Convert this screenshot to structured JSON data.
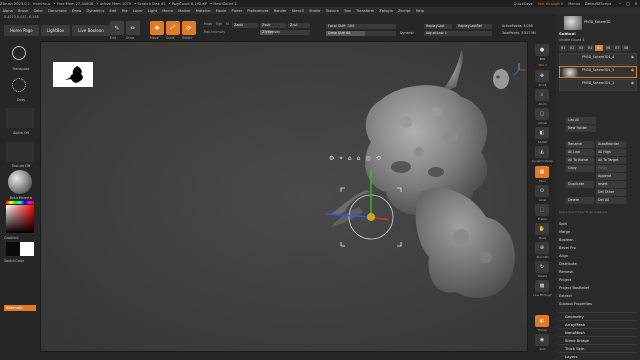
{
  "titlebar": {
    "app": "ZBrush 2023.0.1",
    "project": "rmmmruc",
    "free_mem": "• Free Mem 27.344GB",
    "active_mem": "• Active Mem 1079",
    "scratch_disk": "• Scratch Disk 45",
    "poly_count": "• PolyCount 8.192 KP",
    "mesh_count": "• MeshCount 1",
    "quicksave": "QuickSave",
    "see_through": "See-through 0",
    "menus": "Menus",
    "default_script": "DefaultZScript"
  },
  "menubar": {
    "items": [
      "Alpha",
      "Brush",
      "Color",
      "Document",
      "Draw",
      "Dynamics",
      "Edit",
      "File",
      "Layer",
      "Light",
      "Macro",
      "Marker",
      "Material",
      "Movie",
      "Picker",
      "Preferences",
      "Render",
      "Stencil",
      "Stroke",
      "Texture",
      "Tool",
      "Transform",
      "Zplugin",
      "Zscript",
      "Help"
    ]
  },
  "leftinfo": {
    "coords": "0.4273,0.011,-0.158"
  },
  "lefttabs": [
    "Home Page",
    "LightBox",
    "Live Boolean"
  ],
  "toolbar": {
    "edit": "Edit",
    "draw": "Draw",
    "move": "Move",
    "scale": "Scale",
    "rotate": "Rotate",
    "mrgb": "Mrgb",
    "rgb": "Rgb",
    "m": "M",
    "zadd": "Zadd",
    "zsub": "Zsub",
    "zcut": "Zcut",
    "rgb_intensity": "Rgb Intensity",
    "z_intensity": "Z Intensity",
    "focal_shift_label": "Focal Shift -100",
    "draw_size_label": "Draw Size 64",
    "dynamic": "Dynamic",
    "rgb_intensity_level": 0.4,
    "z_intensity_level": 0.25,
    "focal_shift_level": 0.0,
    "draw_size_level": 0.55,
    "repl_last": "ReplayLast",
    "repl_last_rel": "ReplayLastRel",
    "adjust_last": "AdjustLast 1",
    "active_points": "ActivePoints: 8,058",
    "total_points": "TotalPoints: 3.517 Mil"
  },
  "leftcol": {
    "transpose": "Transpose",
    "dots": "Dots",
    "alpha_off": "Alpha Off",
    "texture_off": "Texture Off",
    "material": "BasicMaterial",
    "gradient": "Gradient",
    "switch_color": "SwitchColor",
    "alternate": "Alternate"
  },
  "navcol": {
    "items": [
      "BPR",
      "SPix 3",
      "Scroll",
      "Zoom",
      "Actual",
      "AAHalf",
      "Dynamic Persp",
      "Floor",
      "Local",
      "Frame",
      "Move",
      "Zoom3D",
      "Rotate",
      "Line Fill PolyF",
      "Transp",
      "Ghost",
      "Solo",
      "Xpose"
    ]
  },
  "rpanel": {
    "top_thumb_name": "PM3D_Sphere3D",
    "subtool_title": "Subtool",
    "visible_count": "Visible Count 4",
    "vtabs": [
      "V1",
      "V2",
      "V3",
      "V4",
      "V5",
      "V6",
      "V7",
      "V8"
    ],
    "subtools": [
      "PM3D_Sphere3D1_4",
      "PM3D_Sphere3D1_5",
      "PM3D_Sphere3D1_3"
    ],
    "list_all": "List All",
    "new_folder": "New Folder",
    "actions": [
      [
        "Rename",
        "AutoReorder"
      ],
      [
        "All Low",
        "All High"
      ],
      [
        "All To Home",
        "All To Target"
      ],
      [
        "Copy",
        "Paste"
      ],
      [
        "",
        "Append"
      ],
      [
        "Duplicate",
        "Insert"
      ],
      [
        "",
        "Del Other"
      ],
      [
        "Delete",
        "Del All"
      ]
    ],
    "copy_paste_hint": "Apply Sub Folder To All Subtools",
    "list_items": [
      "Split",
      "Merge",
      "Boolean",
      "Bevel Pro",
      "Align",
      "Distribute",
      "Remesh",
      "Project",
      "Project BasRelief",
      "Extract",
      "Subtool Properties"
    ],
    "sections": [
      "Geometry",
      "ArrayMesh",
      "NanoMesh",
      "Slime Bridge",
      "Thick Skin",
      "Layers"
    ]
  },
  "colors": {
    "accent": "#e07a26",
    "panel": "#2a2a2a",
    "canvas": "#404040",
    "model": "#8c8c8c"
  }
}
